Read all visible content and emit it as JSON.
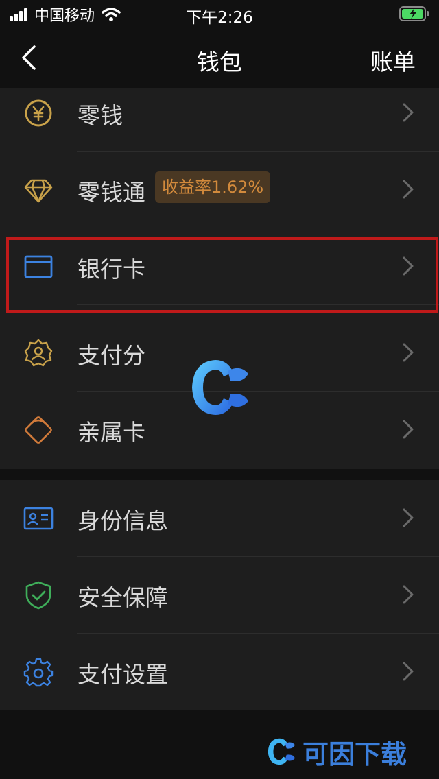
{
  "status_bar": {
    "carrier": "中国移动",
    "time": "下午2:26"
  },
  "nav": {
    "title": "钱包",
    "right_action": "账单"
  },
  "groups": [
    {
      "items": [
        {
          "label": "零钱",
          "icon": "yuan-coin-icon"
        },
        {
          "label": "零钱通",
          "icon": "diamond-icon",
          "badge": "收益率1.62%"
        },
        {
          "label": "银行卡",
          "icon": "bank-card-icon",
          "highlighted": true
        },
        {
          "label": "支付分",
          "icon": "pay-score-badge-icon"
        },
        {
          "label": "亲属卡",
          "icon": "family-card-icon"
        }
      ]
    },
    {
      "items": [
        {
          "label": "身份信息",
          "icon": "id-card-icon"
        },
        {
          "label": "安全保障",
          "icon": "shield-check-icon"
        },
        {
          "label": "支付设置",
          "icon": "gear-icon"
        }
      ]
    }
  ],
  "watermark": {
    "brand_text": "可因下载"
  },
  "colors": {
    "background": "#111111",
    "row_background": "#1e1e1e",
    "gold_icon": "#c9a24a",
    "blue_icon": "#3c82e0",
    "green_icon": "#3fae5a",
    "orange_icon": "#d07a3a",
    "badge_background": "#4a3823",
    "badge_text": "#d28a3c",
    "highlight_border": "#c01a1a"
  }
}
